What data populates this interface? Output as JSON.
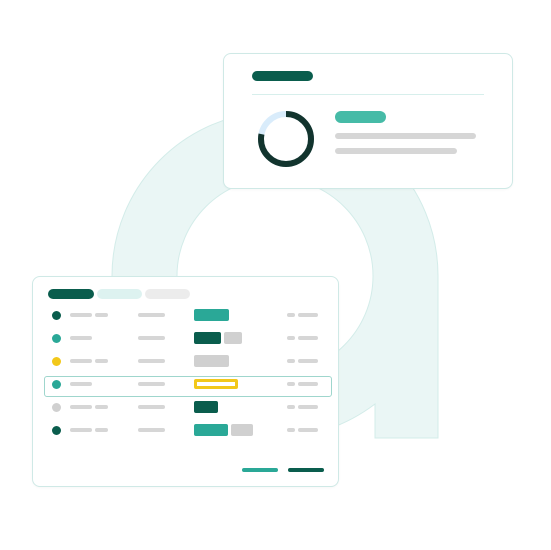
{
  "colors": {
    "dark_green": "#0a5d4d",
    "teal": "#2aa897",
    "mint": "#46bba7",
    "yellow": "#f2c81a",
    "gray": "#d0d0d0",
    "light_gray": "#ececec",
    "pale_teal": "#ddf2f0",
    "ring_track": "#d9ecfb",
    "ring_fill": "#12342e",
    "background_shape": "#eaf6f5",
    "card_border": "#cfe9e6"
  },
  "summary_card": {
    "donut": {
      "icon": "donut-chart-icon",
      "filled_fraction": 0.78
    }
  },
  "table": {
    "tabs": [
      {
        "state": "active",
        "color": "#0a5d4d"
      },
      {
        "state": "inactive",
        "color": "#ddf2f0"
      },
      {
        "state": "inactive",
        "color": "#ececec"
      }
    ],
    "rows": [
      {
        "status_color": "#0a5d4d",
        "chips": [
          {
            "color": "#2aa897"
          }
        ],
        "highlighted": false
      },
      {
        "status_color": "#2aa897",
        "chips": [
          {
            "color": "#0a5d4d"
          },
          {
            "color": "#d0d0d0"
          }
        ],
        "highlighted": false
      },
      {
        "status_color": "#f2c81a",
        "chips": [
          {
            "color": "#d0d0d0"
          }
        ],
        "highlighted": false
      },
      {
        "status_color": "#2aa897",
        "chips": [
          {
            "color": "#f2c81a",
            "outlined": true
          }
        ],
        "highlighted": true
      },
      {
        "status_color": "#d0d0d0",
        "chips": [
          {
            "color": "#0a5d4d"
          }
        ],
        "highlighted": false
      },
      {
        "status_color": "#0a5d4d",
        "chips": [
          {
            "color": "#2aa897"
          },
          {
            "color": "#d0d0d0"
          }
        ],
        "highlighted": false
      }
    ],
    "actions": [
      {
        "name": "secondary-action",
        "color": "#2aa897"
      },
      {
        "name": "primary-action",
        "color": "#0a5d4d"
      }
    ]
  }
}
